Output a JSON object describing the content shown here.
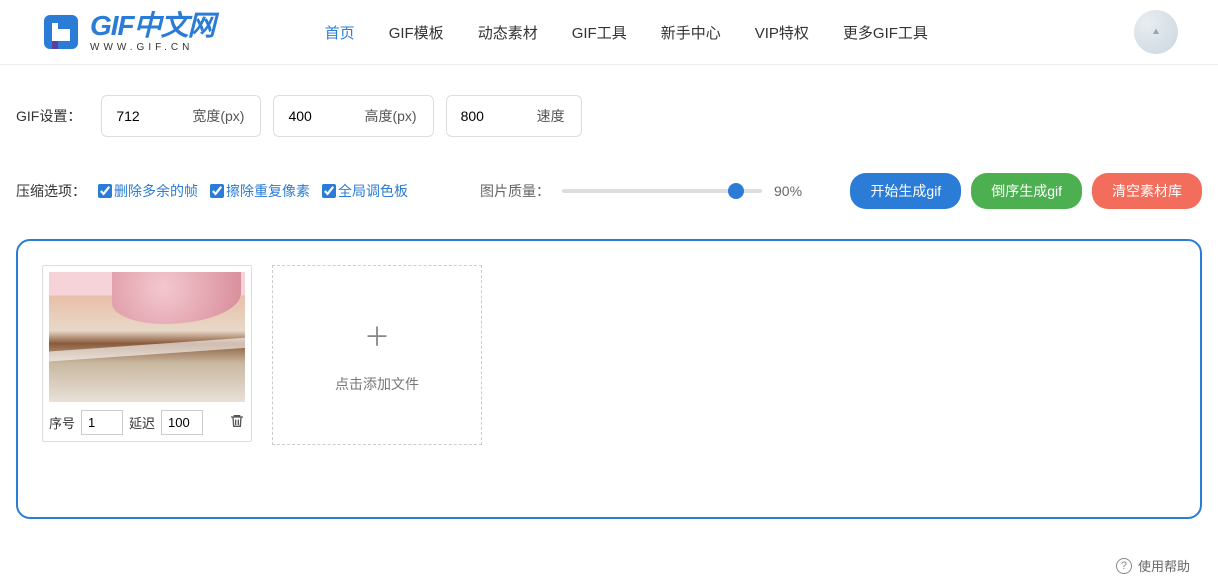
{
  "logo": {
    "main": "GIF中文网",
    "sub": "WWW.GIF.CN"
  },
  "nav": [
    "首页",
    "GIF模板",
    "动态素材",
    "GIF工具",
    "新手中心",
    "VIP特权",
    "更多GIF工具"
  ],
  "nav_active_index": 0,
  "settings": {
    "label": "GIF设置：",
    "width_value": "712",
    "width_unit": "宽度(px)",
    "height_value": "400",
    "height_unit": "高度(px)",
    "speed_value": "800",
    "speed_unit": "速度"
  },
  "compress": {
    "label": "压缩选项：",
    "opt1": "删除多余的帧",
    "opt2": "擦除重复像素",
    "opt3": "全局调色板"
  },
  "quality": {
    "label": "图片质量：",
    "value": 90,
    "display": "90%"
  },
  "buttons": {
    "start": "开始生成gif",
    "reverse": "倒序生成gif",
    "clear": "清空素材库"
  },
  "frame": {
    "seq_label": "序号",
    "seq_value": "1",
    "delay_label": "延迟",
    "delay_value": "100"
  },
  "add_card": "点击添加文件",
  "help": "使用帮助"
}
